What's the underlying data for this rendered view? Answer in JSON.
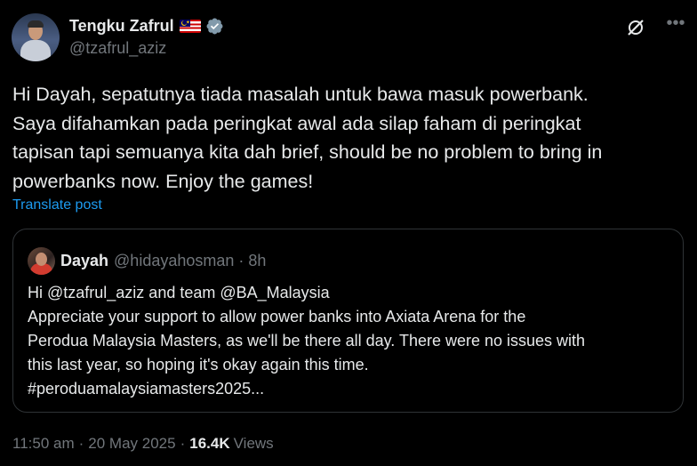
{
  "author": {
    "display_name": "Tengku Zafrul",
    "handle": "@tzafrul_aziz",
    "flag_icon": "malaysia-flag-icon",
    "verified_icon": "verified-badge-icon",
    "verified_color": "#829aab"
  },
  "post": {
    "lines": [
      "Hi Dayah, sepatutnya tiada masalah untuk bawa masuk powerbank.",
      "Saya difahamkan pada peringkat awal ada silap faham di peringkat",
      "tapisan tapi semuanya kita dah brief, should be no problem to bring in",
      "powerbanks now. Enjoy the games!"
    ],
    "translate_label": "Translate post"
  },
  "quote": {
    "name": "Dayah",
    "handle_time": "@hidayahosman · 8h",
    "lines": [
      "Hi @tzafrul_aziz  and team @BA_Malaysia",
      "Appreciate your support to allow power banks into Axiata Arena for the",
      "Perodua Malaysia Masters, as we'll be there all day. There were no issues with",
      "this last year, so hoping it's okay again this time.",
      "#peroduamalaysiamasters2025..."
    ]
  },
  "meta": {
    "time": "11:50 am",
    "date": "20 May 2025",
    "separator": "·",
    "views_count": "16.4K",
    "views_label": "Views"
  },
  "colors": {
    "background": "#000000",
    "text": "#e7e9ea",
    "muted": "#71767b",
    "link": "#1d9bf0",
    "border": "#2f3336"
  }
}
